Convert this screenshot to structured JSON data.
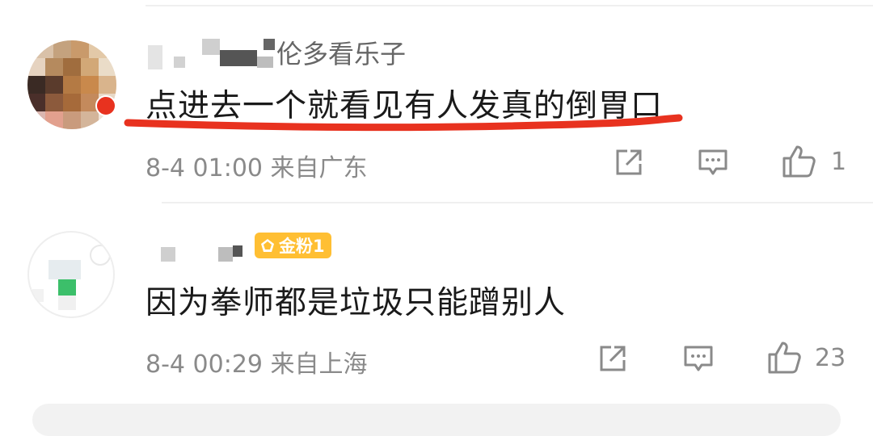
{
  "comments": [
    {
      "username_suffix": "伦多看乐子",
      "text": "点进去一个就看见有人发真的倒胃口",
      "meta": "8-4 01:00 来自广东",
      "likes": "1"
    },
    {
      "badge": "金粉1",
      "text": "因为拳师都是垃圾只能蹭别人",
      "meta": "8-4 00:29 来自上海",
      "likes": "23"
    }
  ],
  "colors": {
    "underline": "#e8321f",
    "badge": "#ffbf33",
    "muted_text": "#8a8a8a"
  },
  "icons": [
    "share-icon",
    "comment-icon",
    "like-icon"
  ]
}
